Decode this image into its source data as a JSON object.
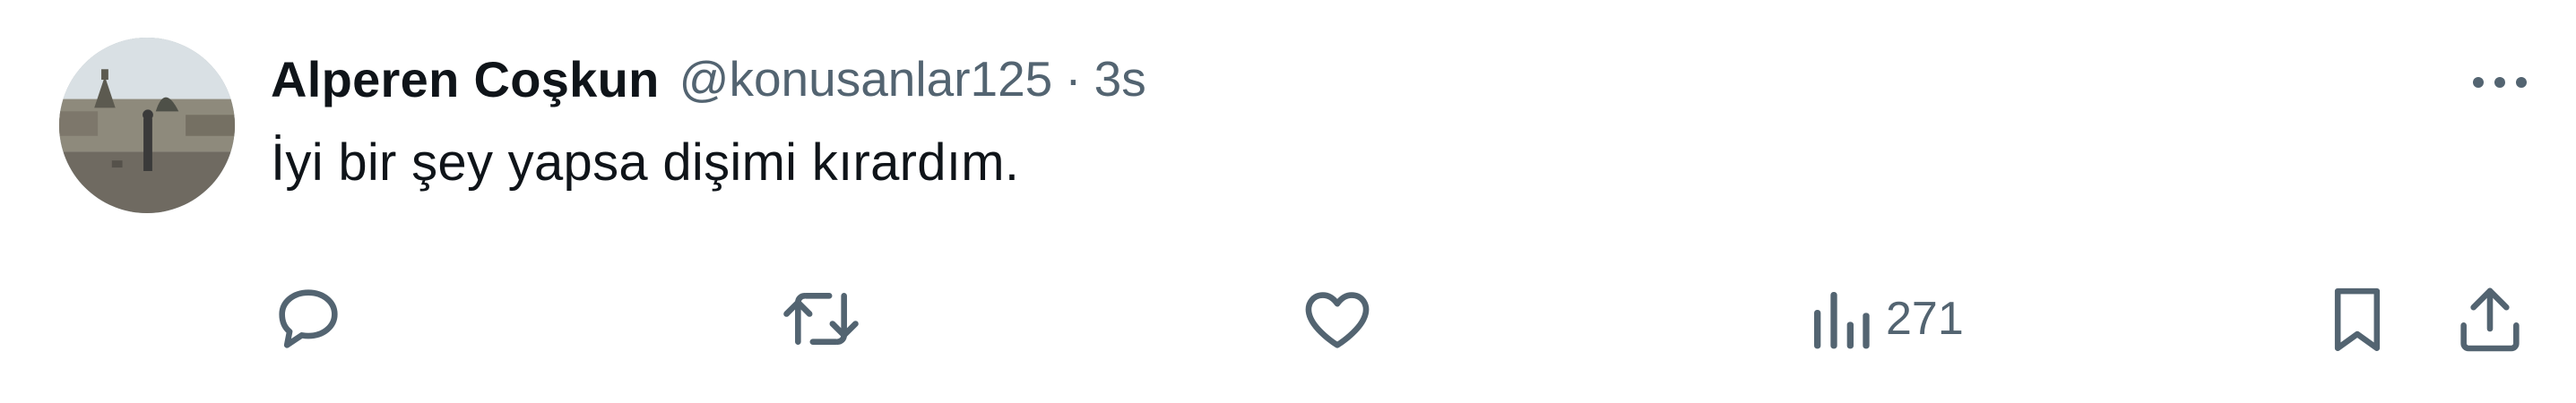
{
  "tweet": {
    "author_name": "Alperen Coşkun",
    "handle": "@konusanlar125",
    "separator": "·",
    "time": "3s",
    "text": "İyi bir şey yapsa dişimi kırardım."
  },
  "actions": {
    "views_count": "271"
  },
  "icons": {
    "reply": "reply-icon",
    "retweet": "retweet-icon",
    "like": "heart-icon",
    "views": "views-chart-icon",
    "bookmark": "bookmark-icon",
    "share": "share-icon",
    "more": "more-dots-icon"
  },
  "colors": {
    "text_primary": "#0f1419",
    "text_secondary": "#536471",
    "background": "#ffffff"
  }
}
